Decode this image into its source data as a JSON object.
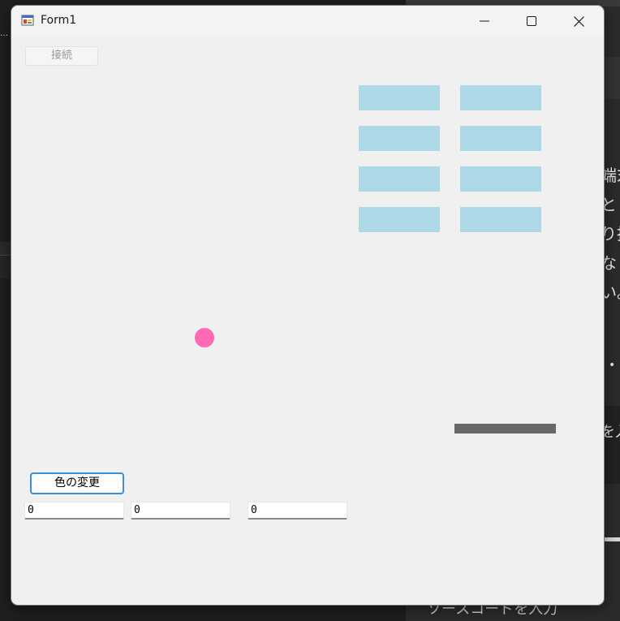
{
  "background": {
    "left_fragment": "…",
    "right_fragments": [
      "端末",
      "と",
      "り指",
      "なし",
      "い。",
      "•"
    ],
    "right_paddle_fragment": "を入",
    "bottom_fragment": "ソースコードを入力"
  },
  "window": {
    "title": "Form1",
    "controls": {
      "minimize": "minimize",
      "maximize": "maximize",
      "close": "close"
    }
  },
  "form": {
    "connect_button": "接続",
    "color_button": "色の変更",
    "inputs": [
      "0",
      "0",
      "0"
    ]
  },
  "game": {
    "brick_color": "#add8e6",
    "ball_color": "#ff69b4",
    "paddle_color": "#696969",
    "brick_rows": 4,
    "brick_columns": 2
  }
}
